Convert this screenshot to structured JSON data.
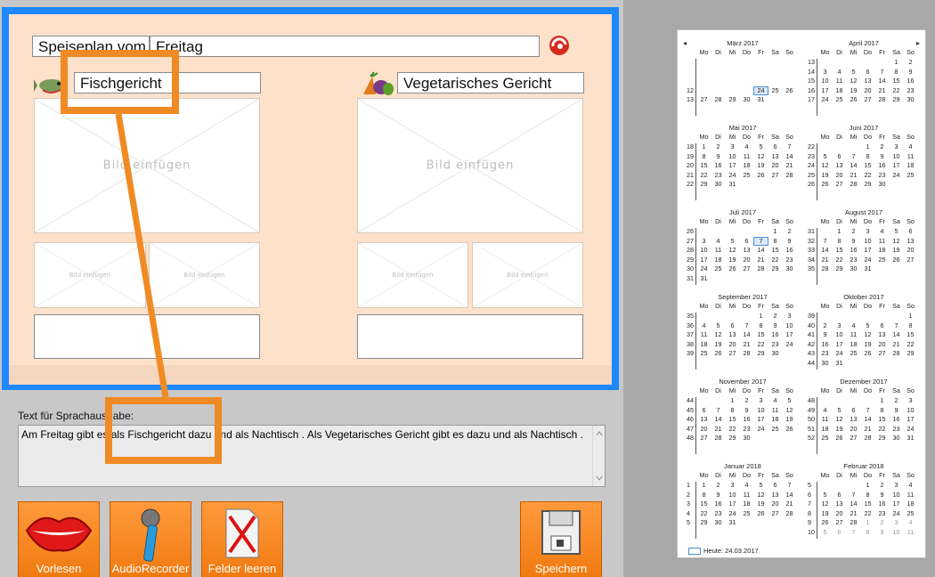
{
  "menu_title": {
    "label": "Speiseplan vom",
    "value": "Freitag"
  },
  "dish_left": {
    "label": "Fischgericht"
  },
  "dish_right": {
    "label": "Vegetarisches Gericht"
  },
  "image_placeholder": "Bild einfügen",
  "speech": {
    "label": "Text für Sprachausgabe:",
    "text": "Am Freitag gibt es  als Fischgericht  dazu  und als Nachtisch . Als Vegetarisches Gericht gibt es  dazu  und als Nachtisch ."
  },
  "toolbar": {
    "read_label": "Vorlesen",
    "recorder_label": "AudioRecorder",
    "clear_label": "Felder leeren",
    "save_label": "Speichern"
  },
  "calendar": {
    "prev": "◂",
    "next": "▸",
    "weekdays": [
      "Mo",
      "Di",
      "Mi",
      "Do",
      "Fr",
      "Sa",
      "So"
    ],
    "today_label": "Heute: 24.03.2017",
    "months": [
      {
        "title": "März 2017",
        "rows": [
          {
            "wk": "",
            "days": [
              "",
              "",
              "",
              "",
              "",
              "",
              ""
            ]
          },
          {
            "wk": "",
            "days": [
              "",
              "",
              "",
              "",
              "",
              "",
              ""
            ]
          },
          {
            "wk": "",
            "days": [
              "",
              "",
              "",
              "",
              "",
              "",
              ""
            ]
          },
          {
            "wk": "12",
            "days": [
              "",
              "",
              "",
              "",
              "24",
              "25",
              "26"
            ]
          },
          {
            "wk": "13",
            "days": [
              "27",
              "28",
              "29",
              "30",
              "31",
              "",
              ""
            ]
          },
          {
            "wk": "",
            "days": [
              "",
              "",
              "",
              "",
              "",
              "",
              ""
            ]
          }
        ],
        "selected": "24"
      },
      {
        "title": "April 2017",
        "rows": [
          {
            "wk": "13",
            "days": [
              "",
              "",
              "",
              "",
              "",
              "1",
              "2"
            ]
          },
          {
            "wk": "14",
            "days": [
              "3",
              "4",
              "5",
              "6",
              "7",
              "8",
              "9"
            ]
          },
          {
            "wk": "15",
            "days": [
              "10",
              "11",
              "12",
              "13",
              "14",
              "15",
              "16"
            ]
          },
          {
            "wk": "16",
            "days": [
              "17",
              "18",
              "19",
              "20",
              "21",
              "22",
              "23"
            ]
          },
          {
            "wk": "17",
            "days": [
              "24",
              "25",
              "26",
              "27",
              "28",
              "29",
              "30"
            ]
          },
          {
            "wk": "",
            "days": [
              "",
              "",
              "",
              "",
              "",
              "",
              ""
            ]
          }
        ]
      },
      {
        "title": "Mai 2017",
        "rows": [
          {
            "wk": "18",
            "days": [
              "1",
              "2",
              "3",
              "4",
              "5",
              "6",
              "7"
            ]
          },
          {
            "wk": "19",
            "days": [
              "8",
              "9",
              "10",
              "11",
              "12",
              "13",
              "14"
            ]
          },
          {
            "wk": "20",
            "days": [
              "15",
              "16",
              "17",
              "18",
              "19",
              "20",
              "21"
            ]
          },
          {
            "wk": "21",
            "days": [
              "22",
              "23",
              "24",
              "25",
              "26",
              "27",
              "28"
            ]
          },
          {
            "wk": "22",
            "days": [
              "29",
              "30",
              "31",
              "",
              "",
              "",
              ""
            ]
          },
          {
            "wk": "",
            "days": [
              "",
              "",
              "",
              "",
              "",
              "",
              ""
            ]
          }
        ]
      },
      {
        "title": "Juni 2017",
        "rows": [
          {
            "wk": "22",
            "days": [
              "",
              "",
              "",
              "1",
              "2",
              "3",
              "4"
            ]
          },
          {
            "wk": "23",
            "days": [
              "5",
              "6",
              "7",
              "8",
              "9",
              "10",
              "11"
            ]
          },
          {
            "wk": "24",
            "days": [
              "12",
              "13",
              "14",
              "15",
              "16",
              "17",
              "18"
            ]
          },
          {
            "wk": "25",
            "days": [
              "19",
              "20",
              "21",
              "22",
              "23",
              "24",
              "25"
            ]
          },
          {
            "wk": "26",
            "days": [
              "26",
              "27",
              "28",
              "29",
              "30",
              "",
              ""
            ]
          },
          {
            "wk": "",
            "days": [
              "",
              "",
              "",
              "",
              "",
              "",
              ""
            ]
          }
        ]
      },
      {
        "title": "Juli 2017",
        "rows": [
          {
            "wk": "26",
            "days": [
              "",
              "",
              "",
              "",
              "",
              "1",
              "2"
            ]
          },
          {
            "wk": "27",
            "days": [
              "3",
              "4",
              "5",
              "6",
              "7",
              "8",
              "9"
            ]
          },
          {
            "wk": "28",
            "days": [
              "10",
              "11",
              "12",
              "13",
              "14",
              "15",
              "16"
            ]
          },
          {
            "wk": "29",
            "days": [
              "17",
              "18",
              "19",
              "20",
              "21",
              "22",
              "23"
            ]
          },
          {
            "wk": "30",
            "days": [
              "24",
              "25",
              "26",
              "27",
              "28",
              "29",
              "30"
            ]
          },
          {
            "wk": "31",
            "days": [
              "31",
              "",
              "",
              "",
              "",
              "",
              ""
            ]
          }
        ],
        "selected": "7"
      },
      {
        "title": "August 2017",
        "rows": [
          {
            "wk": "31",
            "days": [
              "",
              "1",
              "2",
              "3",
              "4",
              "5",
              "6"
            ]
          },
          {
            "wk": "32",
            "days": [
              "7",
              "8",
              "9",
              "10",
              "11",
              "12",
              "13"
            ]
          },
          {
            "wk": "33",
            "days": [
              "14",
              "15",
              "16",
              "17",
              "18",
              "19",
              "20"
            ]
          },
          {
            "wk": "34",
            "days": [
              "21",
              "22",
              "23",
              "24",
              "25",
              "26",
              "27"
            ]
          },
          {
            "wk": "35",
            "days": [
              "28",
              "29",
              "30",
              "31",
              "",
              "",
              ""
            ]
          },
          {
            "wk": "",
            "days": [
              "",
              "",
              "",
              "",
              "",
              "",
              ""
            ]
          }
        ]
      },
      {
        "title": "September 2017",
        "rows": [
          {
            "wk": "35",
            "days": [
              "",
              "",
              "",
              "",
              "1",
              "2",
              "3"
            ]
          },
          {
            "wk": "36",
            "days": [
              "4",
              "5",
              "6",
              "7",
              "8",
              "9",
              "10"
            ]
          },
          {
            "wk": "37",
            "days": [
              "11",
              "12",
              "13",
              "14",
              "15",
              "16",
              "17"
            ]
          },
          {
            "wk": "38",
            "days": [
              "18",
              "19",
              "20",
              "21",
              "22",
              "23",
              "24"
            ]
          },
          {
            "wk": "39",
            "days": [
              "25",
              "26",
              "27",
              "28",
              "29",
              "30",
              ""
            ]
          },
          {
            "wk": "",
            "days": [
              "",
              "",
              "",
              "",
              "",
              "",
              ""
            ]
          }
        ]
      },
      {
        "title": "Oktober 2017",
        "rows": [
          {
            "wk": "39",
            "days": [
              "",
              "",
              "",
              "",
              "",
              "",
              "1"
            ]
          },
          {
            "wk": "40",
            "days": [
              "2",
              "3",
              "4",
              "5",
              "6",
              "7",
              "8"
            ]
          },
          {
            "wk": "41",
            "days": [
              "9",
              "10",
              "11",
              "12",
              "13",
              "14",
              "15"
            ]
          },
          {
            "wk": "42",
            "days": [
              "16",
              "17",
              "18",
              "19",
              "20",
              "21",
              "22"
            ]
          },
          {
            "wk": "43",
            "days": [
              "23",
              "24",
              "25",
              "26",
              "27",
              "28",
              "29"
            ]
          },
          {
            "wk": "44",
            "days": [
              "30",
              "31",
              "",
              "",
              "",
              "",
              ""
            ]
          }
        ]
      },
      {
        "title": "November 2017",
        "rows": [
          {
            "wk": "44",
            "days": [
              "",
              "",
              "1",
              "2",
              "3",
              "4",
              "5"
            ]
          },
          {
            "wk": "45",
            "days": [
              "6",
              "7",
              "8",
              "9",
              "10",
              "11",
              "12"
            ]
          },
          {
            "wk": "46",
            "days": [
              "13",
              "14",
              "15",
              "16",
              "17",
              "18",
              "19"
            ]
          },
          {
            "wk": "47",
            "days": [
              "20",
              "21",
              "22",
              "23",
              "24",
              "25",
              "26"
            ]
          },
          {
            "wk": "48",
            "days": [
              "27",
              "28",
              "29",
              "30",
              "",
              "",
              ""
            ]
          },
          {
            "wk": "",
            "days": [
              "",
              "",
              "",
              "",
              "",
              "",
              ""
            ]
          }
        ]
      },
      {
        "title": "Dezember 2017",
        "rows": [
          {
            "wk": "48",
            "days": [
              "",
              "",
              "",
              "",
              "1",
              "2",
              "3"
            ]
          },
          {
            "wk": "49",
            "days": [
              "4",
              "5",
              "6",
              "7",
              "8",
              "9",
              "10"
            ]
          },
          {
            "wk": "50",
            "days": [
              "11",
              "12",
              "13",
              "14",
              "15",
              "16",
              "17"
            ]
          },
          {
            "wk": "51",
            "days": [
              "18",
              "19",
              "20",
              "21",
              "22",
              "23",
              "24"
            ]
          },
          {
            "wk": "52",
            "days": [
              "25",
              "26",
              "27",
              "28",
              "29",
              "30",
              "31"
            ]
          },
          {
            "wk": "",
            "days": [
              "",
              "",
              "",
              "",
              "",
              "",
              ""
            ]
          }
        ]
      },
      {
        "title": "Januar 2018",
        "rows": [
          {
            "wk": "1",
            "days": [
              "1",
              "2",
              "3",
              "4",
              "5",
              "6",
              "7"
            ]
          },
          {
            "wk": "2",
            "days": [
              "8",
              "9",
              "10",
              "11",
              "12",
              "13",
              "14"
            ]
          },
          {
            "wk": "3",
            "days": [
              "15",
              "16",
              "17",
              "18",
              "19",
              "20",
              "21"
            ]
          },
          {
            "wk": "4",
            "days": [
              "22",
              "23",
              "24",
              "25",
              "26",
              "27",
              "28"
            ]
          },
          {
            "wk": "5",
            "days": [
              "29",
              "30",
              "31",
              "",
              "",
              "",
              ""
            ]
          },
          {
            "wk": "",
            "days": [
              "",
              "",
              "",
              "",
              "",
              "",
              ""
            ]
          }
        ]
      },
      {
        "title": "Februar 2018",
        "rows": [
          {
            "wk": "5",
            "days": [
              "",
              "",
              "",
              "1",
              "2",
              "3",
              "4"
            ]
          },
          {
            "wk": "6",
            "days": [
              "5",
              "6",
              "7",
              "8",
              "9",
              "10",
              "11"
            ]
          },
          {
            "wk": "7",
            "days": [
              "12",
              "13",
              "14",
              "15",
              "16",
              "17",
              "18"
            ]
          },
          {
            "wk": "8",
            "days": [
              "19",
              "20",
              "21",
              "22",
              "23",
              "24",
              "25"
            ]
          },
          {
            "wk": "9",
            "days": [
              "26",
              "27",
              "28",
              "1",
              "2",
              "3",
              "4"
            ]
          },
          {
            "wk": "10",
            "days": [
              "5",
              "6",
              "7",
              "8",
              "9",
              "10",
              "11"
            ]
          }
        ],
        "gray_from_row": 4
      }
    ]
  }
}
